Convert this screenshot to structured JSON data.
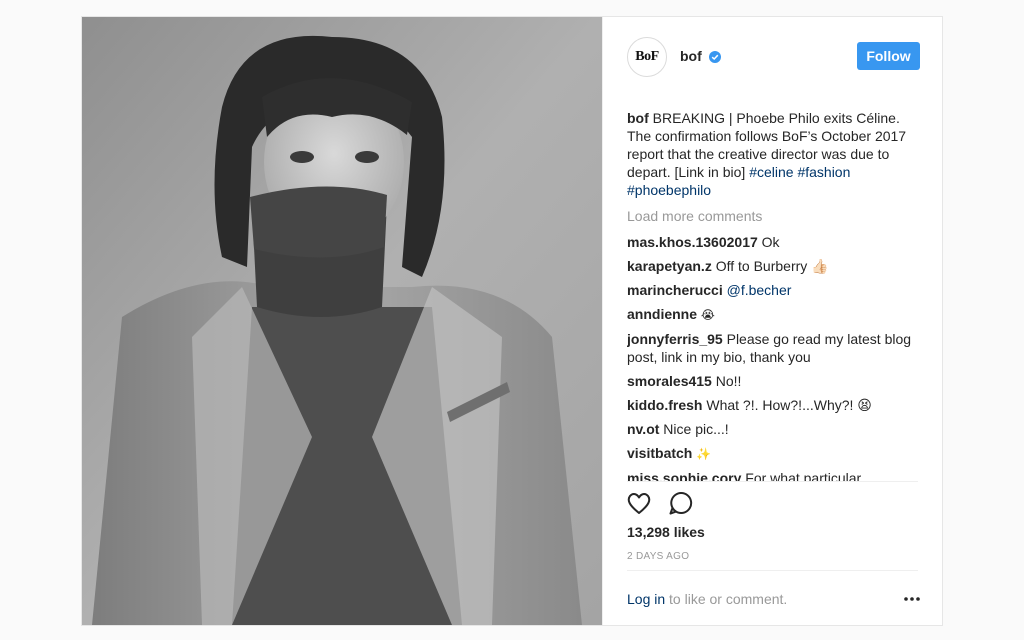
{
  "post": {
    "account": {
      "avatar_text": "BoF",
      "username": "bof",
      "verified_icon": "verified-badge-icon",
      "follow_label": "Follow"
    },
    "caption": {
      "username": "bof",
      "text": "BREAKING | Phoebe Philo exits Céline. The confirmation follows BoF’s October 2017 report that the creative director was due to depart. [Link in bio]",
      "hashtags": [
        "#celine",
        "#fashion",
        "#phoebephilo"
      ]
    },
    "load_more": "Load more comments",
    "comments": [
      {
        "user": "mas.khos.13602017",
        "text": "Ok"
      },
      {
        "user": "karapetyan.z",
        "text": "Off to Burberry 👍🏻"
      },
      {
        "user": "marincherucci",
        "text": "@f.becher"
      },
      {
        "user": "anndienne",
        "text": "😭"
      },
      {
        "user": "jonnyferris_95",
        "text": "Please go read my latest blog post, link in my bio, thank you"
      },
      {
        "user": "smorales415",
        "text": "No!!"
      },
      {
        "user": "kiddo.fresh",
        "text": "What ?!. How?!...Why?! 😫"
      },
      {
        "user": "nv.ot",
        "text": "Nice pic...!"
      },
      {
        "user": "visitbatch",
        "text": "✨"
      },
      {
        "user": "miss.sophie.cory",
        "text": "For what particular"
      }
    ],
    "actions": {
      "like_icon": "heart-icon",
      "comment_icon": "comment-bubble-icon"
    },
    "likes": "13,298 likes",
    "timestamp": "2 DAYS AGO",
    "login_link": "Log in",
    "login_rest": " to like or comment.",
    "more_icon": "more-options-icon"
  },
  "colors": {
    "follow_button": "#3897f0",
    "hashtag": "#003569",
    "muted": "#999999"
  }
}
